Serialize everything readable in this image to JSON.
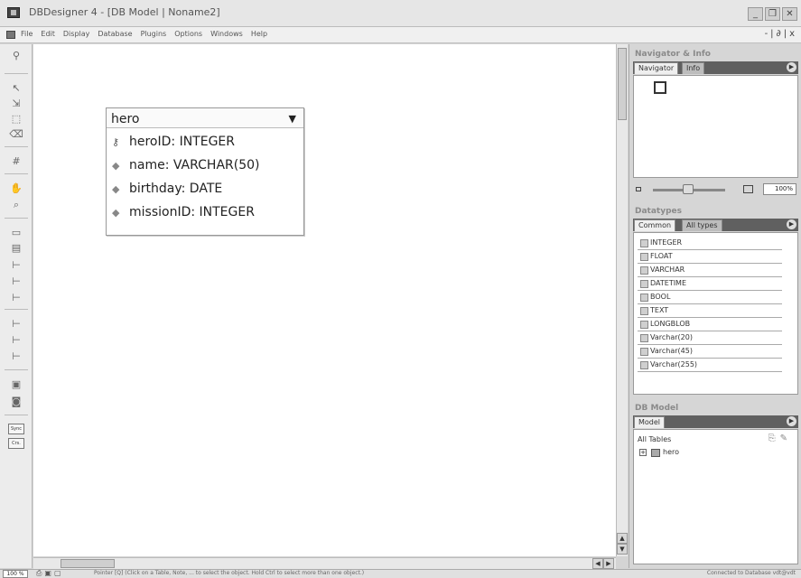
{
  "window": {
    "title": "DBDesigner 4 - [DB Model | Noname2]",
    "controls": [
      "_",
      "❐",
      "✕"
    ]
  },
  "menubar": {
    "items": [
      "File",
      "Edit",
      "Display",
      "Database",
      "Plugins",
      "Options",
      "Windows",
      "Help"
    ],
    "mdi_controls": "-|∂|x"
  },
  "toolbar": {
    "sync_label": "Sync",
    "crs_label": "Crs."
  },
  "table": {
    "name": "hero",
    "dropdown_glyph": "▼",
    "columns": [
      {
        "text": "heroID: INTEGER",
        "icon": "key-icon"
      },
      {
        "text": "name: VARCHAR(50)",
        "icon": "diamond-icon"
      },
      {
        "text": "birthday: DATE",
        "icon": "diamond-icon"
      },
      {
        "text": "missionID: INTEGER",
        "icon": "diamond-icon"
      }
    ]
  },
  "navigator": {
    "title": "Navigator & Info",
    "tabs": [
      "Navigator",
      "Info"
    ],
    "zoom_value": "100%"
  },
  "datatypes": {
    "title": "Datatypes",
    "tabs": [
      "Common",
      "All types"
    ],
    "items": [
      "INTEGER",
      "FLOAT",
      "VARCHAR",
      "DATETIME",
      "BOOL",
      "TEXT",
      "LONGBLOB",
      "Varchar(20)",
      "Varchar(45)",
      "Varchar(255)"
    ]
  },
  "dbmodel": {
    "title": "DB Model",
    "tabs": [
      "Model"
    ],
    "all_tables_label": "All Tables",
    "tree_expand": "⊞",
    "tree_items": [
      "hero"
    ]
  },
  "statusbar": {
    "zoom": "100 %",
    "message": "Pointer [Q] (Click on a Table, Note, ... to select the object. Hold Ctrl to select more than one object.)",
    "connection": "Connected to Database vdt@vdt"
  }
}
